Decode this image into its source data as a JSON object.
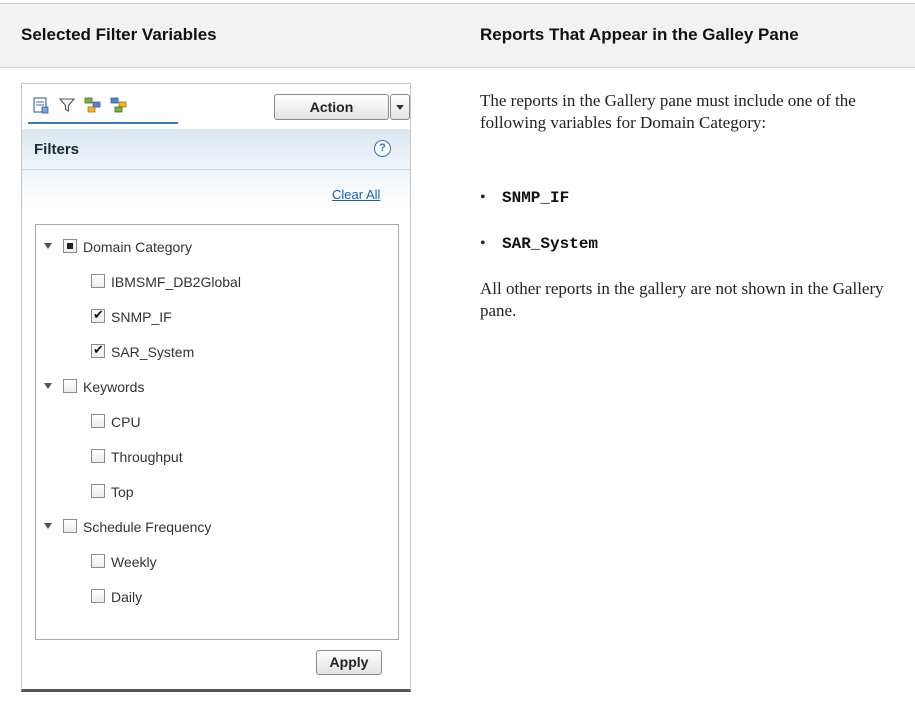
{
  "table": {
    "header_left": "Selected Filter Variables",
    "header_right": "Reports That Appear in the Galley Pane"
  },
  "panel": {
    "toolbar_icons": [
      "report-icon",
      "filter-icon",
      "hierarchy-icon",
      "hierarchy-alt-icon"
    ],
    "action_label": "Action",
    "filters_title": "Filters",
    "help_glyph": "?",
    "clear_all": "Clear All",
    "apply_label": "Apply",
    "tree": [
      {
        "label": "Domain Category",
        "state": "partial",
        "expanded": true
      },
      {
        "label": "IBMSMF_DB2Global",
        "state": "unchecked"
      },
      {
        "label": "SNMP_IF",
        "state": "checked"
      },
      {
        "label": "SAR_System",
        "state": "checked"
      },
      {
        "label": "Keywords",
        "state": "unchecked",
        "expanded": true
      },
      {
        "label": "CPU",
        "state": "unchecked"
      },
      {
        "label": "Throughput",
        "state": "unchecked"
      },
      {
        "label": "Top",
        "state": "unchecked"
      },
      {
        "label": "Schedule Frequency",
        "state": "unchecked",
        "expanded": true
      },
      {
        "label": "Weekly",
        "state": "unchecked"
      },
      {
        "label": "Daily",
        "state": "unchecked"
      }
    ]
  },
  "content": {
    "intro": "The reports in the Gallery pane must include one of the following variables for Domain Category:",
    "bullets": [
      "SNMP_IF",
      "SAR_System"
    ],
    "outro": "All other reports in the gallery are not shown in the Gallery pane.",
    "bullet_glyph": "•"
  },
  "colors": {
    "header_bg": "#f2f2f2",
    "link": "#1a5fb4",
    "accent": "#3a78c8"
  }
}
